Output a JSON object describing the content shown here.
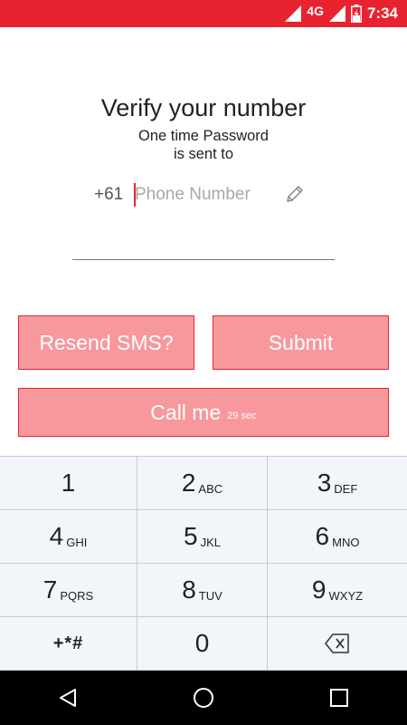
{
  "status_bar": {
    "network": "4G",
    "time": "7:34",
    "icons": [
      "signal-icon",
      "signal-icon",
      "battery-charging-icon"
    ]
  },
  "verify": {
    "title": "Verify your number",
    "subtitle_line1": "One time Password",
    "subtitle_line2": "is sent to",
    "country_code": "+61",
    "phone_value": "",
    "phone_placeholder": "Phone Number",
    "edit_icon": "pencil-icon"
  },
  "buttons": {
    "resend_label": "Resend SMS?",
    "submit_label": "Submit",
    "call_label": "Call me",
    "call_timer": "29 sec"
  },
  "colors": {
    "accent": "#e8232f",
    "button_fill": "#f7989d",
    "keypad_bg": "#f2f6fa",
    "keypad_divider": "#c6ccd2"
  },
  "keypad": {
    "keys": [
      {
        "digit": "1",
        "letters": ""
      },
      {
        "digit": "2",
        "letters": "ABC"
      },
      {
        "digit": "3",
        "letters": "DEF"
      },
      {
        "digit": "4",
        "letters": "GHI"
      },
      {
        "digit": "5",
        "letters": "JKL"
      },
      {
        "digit": "6",
        "letters": "MNO"
      },
      {
        "digit": "7",
        "letters": "PQRS"
      },
      {
        "digit": "8",
        "letters": "TUV"
      },
      {
        "digit": "9",
        "letters": "WXYZ"
      }
    ],
    "symbols": "+*#",
    "zero": "0",
    "backspace_icon": "backspace-icon"
  },
  "nav_bar": {
    "icons": [
      "back-icon",
      "home-icon",
      "recents-icon"
    ]
  }
}
